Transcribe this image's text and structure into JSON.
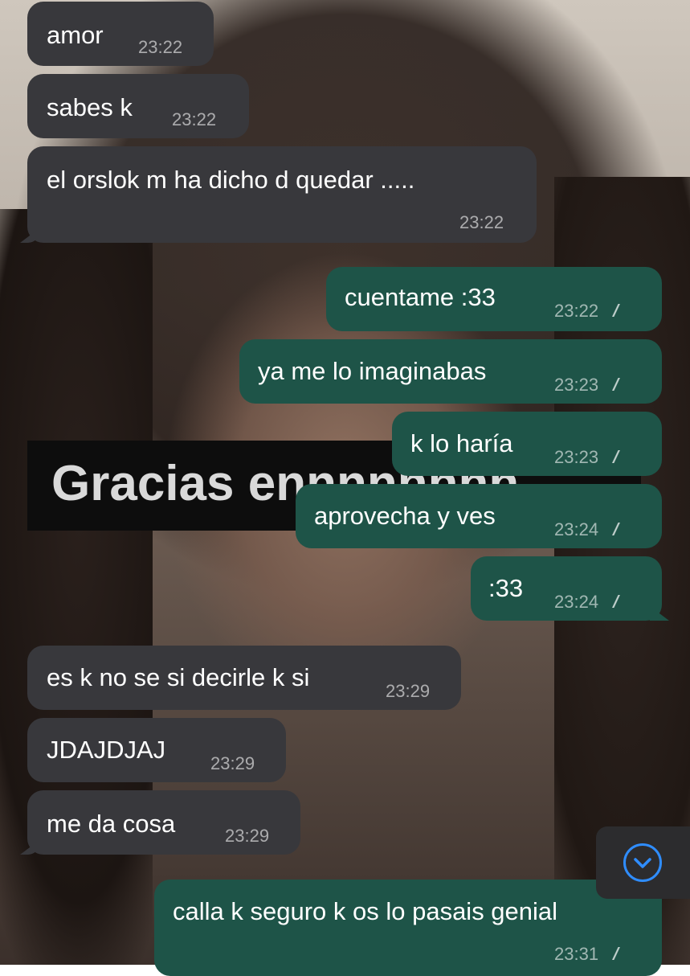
{
  "background": {
    "overlay_text": "Gracias ennnnnnnn"
  },
  "messages": [
    {
      "direction": "in",
      "text": "amor",
      "time": "23:22"
    },
    {
      "direction": "in",
      "text": "sabes k",
      "time": "23:22"
    },
    {
      "direction": "in",
      "text": "el orslok m ha dicho d quedar .....",
      "time": "23:22"
    },
    {
      "direction": "out",
      "text": "cuentame :33",
      "time": "23:22",
      "status": "read"
    },
    {
      "direction": "out",
      "text": "ya me lo imaginabas",
      "time": "23:23",
      "status": "read"
    },
    {
      "direction": "out",
      "text": "k lo haría",
      "time": "23:23",
      "status": "read"
    },
    {
      "direction": "out",
      "text": "aprovecha y ves",
      "time": "23:24",
      "status": "read"
    },
    {
      "direction": "out",
      "text": ":33",
      "time": "23:24",
      "status": "read"
    },
    {
      "direction": "in",
      "text": "es k no se si decirle k si",
      "time": "23:29"
    },
    {
      "direction": "in",
      "text": "JDAJDJAJ",
      "time": "23:29"
    },
    {
      "direction": "in",
      "text": "me da cosa",
      "time": "23:29"
    },
    {
      "direction": "out",
      "text": "calla k seguro k os lo pasais genial",
      "time": "23:31",
      "status": "read"
    }
  ],
  "scroll_to_bottom": {
    "icon": "chevron-down-icon"
  },
  "colors": {
    "incoming_bubble": "#38383c",
    "outgoing_bubble": "#1e5448",
    "accent": "#2f8dff"
  }
}
